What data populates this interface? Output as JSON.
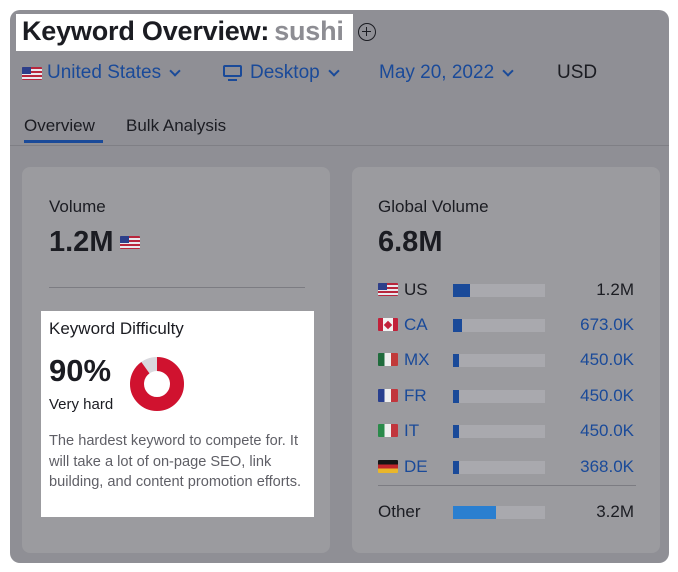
{
  "header": {
    "title_prefix": "Keyword Overview:",
    "keyword": "sushi",
    "add_icon": "plus-circle-icon"
  },
  "filters": {
    "country": "United States",
    "device": "Desktop",
    "date": "May 20, 2022",
    "currency": "USD"
  },
  "tabs": [
    {
      "label": "Overview",
      "active": true
    },
    {
      "label": "Bulk Analysis",
      "active": false
    }
  ],
  "volume": {
    "label": "Volume",
    "value": "1.2M",
    "flag": "us"
  },
  "keyword_difficulty": {
    "label": "Keyword Difficulty",
    "value": "90%",
    "percent": 90,
    "level": "Very hard",
    "description": "The hardest keyword to compete for. It will take a lot of on-page SEO, link building, and content promotion efforts.",
    "color": "#d0122f",
    "track_color": "#d9d9de"
  },
  "global_volume": {
    "label": "Global Volume",
    "value": "6.8M",
    "countries": [
      {
        "code": "US",
        "flag": "us",
        "value": "1.2M",
        "share": 0.18
      },
      {
        "code": "CA",
        "flag": "ca",
        "value": "673.0K",
        "share": 0.1
      },
      {
        "code": "MX",
        "flag": "mx",
        "value": "450.0K",
        "share": 0.07
      },
      {
        "code": "FR",
        "flag": "fr",
        "value": "450.0K",
        "share": 0.07
      },
      {
        "code": "IT",
        "flag": "it",
        "value": "450.0K",
        "share": 0.07
      },
      {
        "code": "DE",
        "flag": "de",
        "value": "368.0K",
        "share": 0.06
      }
    ],
    "other": {
      "label": "Other",
      "value": "3.2M",
      "share": 0.47
    }
  },
  "colors": {
    "accent": "#1a4a99",
    "other_bar": "#2a7fd0"
  }
}
